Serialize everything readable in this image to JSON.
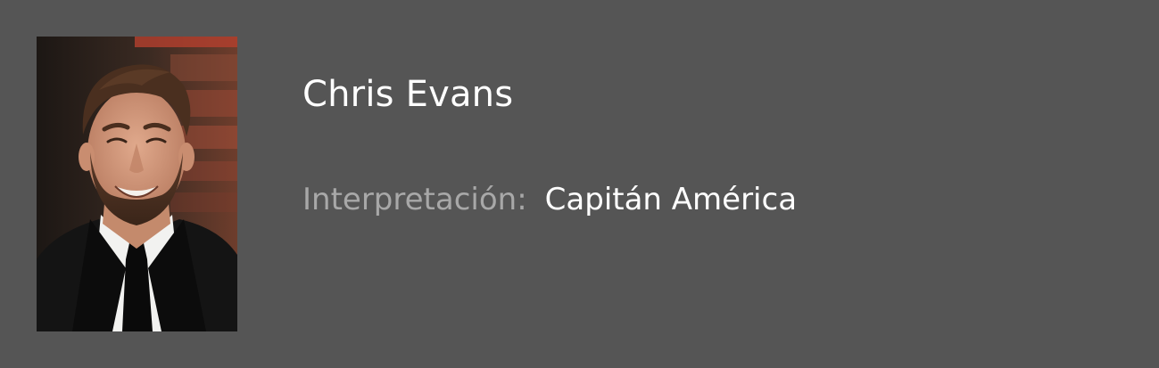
{
  "actor": {
    "name": "Chris Evans",
    "role_label": "Interpretación:",
    "role_value": "Capitán América",
    "photo_icon": "actor-portrait"
  },
  "colors": {
    "background": "#555555",
    "name_text": "#ffffff",
    "label_text": "#a8a8a8",
    "value_text": "#ffffff"
  }
}
